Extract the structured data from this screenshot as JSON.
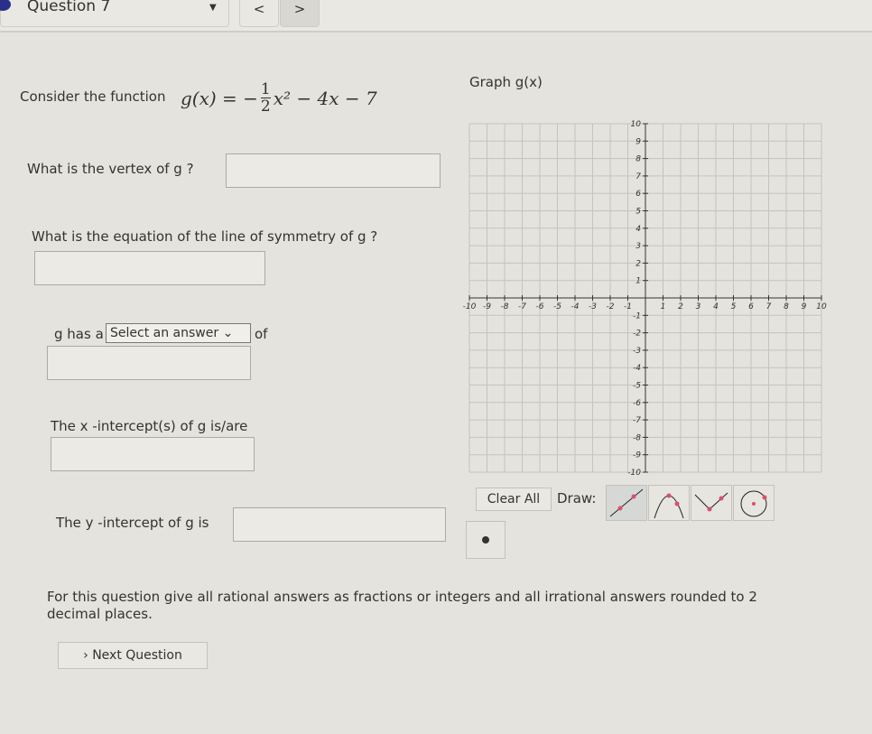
{
  "header": {
    "question_label": "Question 7",
    "prev": "<",
    "next": ">"
  },
  "question": {
    "intro": "Consider the function",
    "function": "g(x) = −½x² − 4x − 7",
    "fn_lhs": "g(x) = −",
    "fn_num": "1",
    "fn_den": "2",
    "fn_rhs": "x² − 4x − 7",
    "vertex_prompt": "What is the vertex of g ?",
    "symmetry_prompt": "What is the equation of the line of symmetry of g ?",
    "g_has_a": "g  has a",
    "select_value": "Select an answer",
    "of": "of",
    "x_intercepts": "The x -intercept(s) of g  is/are",
    "y_intercept": "The y -intercept of g  is",
    "instructions": "For this question give all rational answers as fractions or integers and all irrational answers rounded to 2 decimal places.",
    "next_question": "Next Question"
  },
  "graph": {
    "title": "Graph g(x)",
    "xlim": [
      -10,
      10
    ],
    "ylim": [
      -10,
      10
    ],
    "clear_all": "Clear All",
    "draw": "Draw:",
    "tools": [
      "line-tool-icon",
      "parabola-tool-icon",
      "absolute-value-tool-icon",
      "circle-tool-icon",
      "point-tool-icon"
    ],
    "point_color": "#d9506b"
  }
}
